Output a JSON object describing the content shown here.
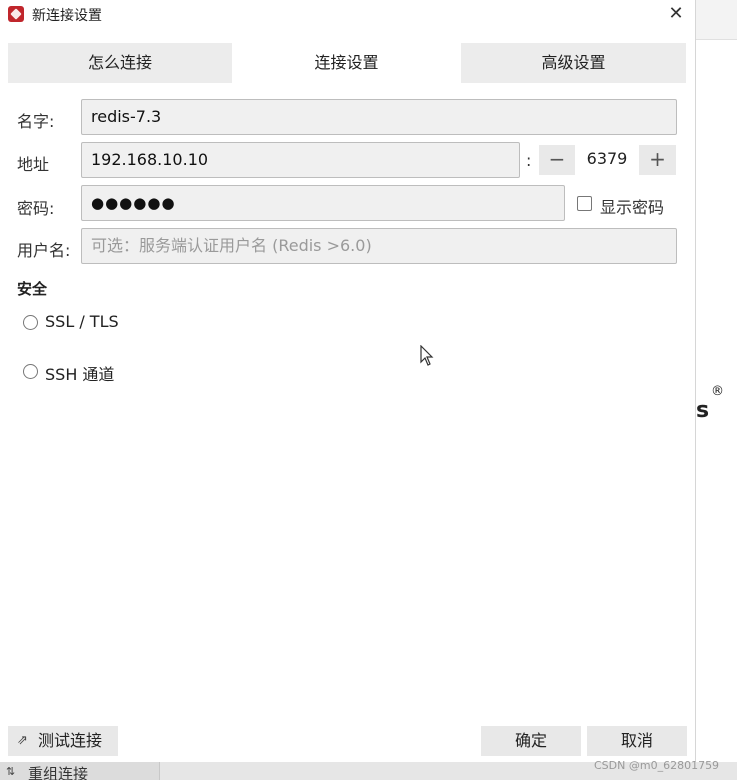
{
  "dialog": {
    "title": "新连接设置",
    "close_label": "✕"
  },
  "tabs": [
    {
      "label": "怎么连接",
      "active": false
    },
    {
      "label": "连接设置",
      "active": true
    },
    {
      "label": "高级设置",
      "active": false
    }
  ],
  "form": {
    "name_label": "名字:",
    "name_value": "redis-7.3",
    "address_label": "地址",
    "address_value": "192.168.10.10",
    "port_separator": ":",
    "port_value": "6379",
    "port_minus": "−",
    "port_plus": "+",
    "password_label": "密码:",
    "password_value": "●●●●●●",
    "show_password_label": "显示密码",
    "username_label": "用户名:",
    "username_placeholder": "可选：服务端认证用户名 (Redis >6.0)"
  },
  "security": {
    "heading": "安全",
    "options": [
      {
        "label": "SSL / TLS"
      },
      {
        "label": "SSH 通道"
      }
    ]
  },
  "buttons": {
    "test_label": "测试连接",
    "ok_label": "确定",
    "cancel_label": "取消"
  },
  "background": {
    "glyph": "s",
    "registered": "®",
    "bottom_item": "重组连接"
  },
  "watermark": "CSDN @m0_62801759"
}
